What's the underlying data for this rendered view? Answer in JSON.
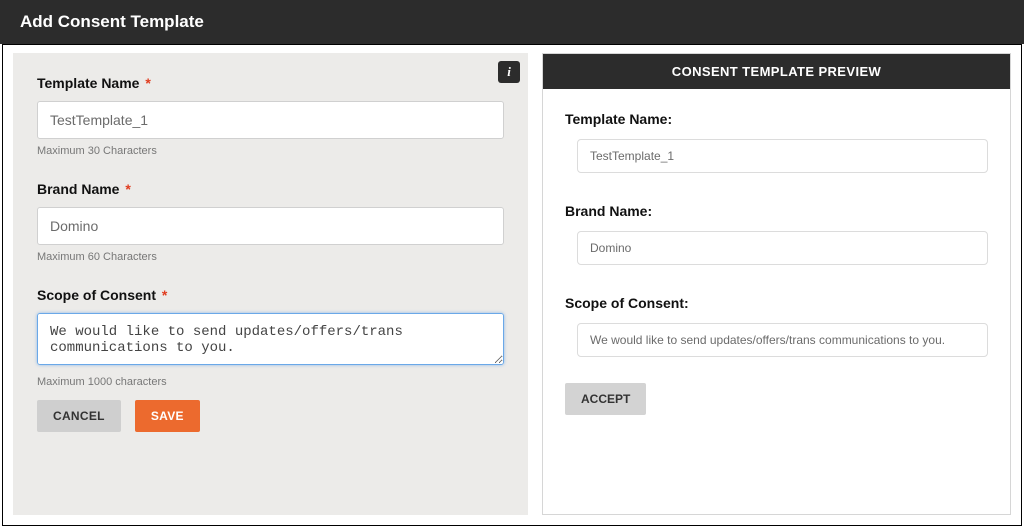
{
  "header": {
    "title": "Add Consent Template"
  },
  "form": {
    "info_icon": "i",
    "template_name": {
      "label": "Template Name",
      "value": "TestTemplate_1",
      "helper": "Maximum 30 Characters"
    },
    "brand_name": {
      "label": "Brand Name",
      "value": "Domino",
      "helper": "Maximum 60 Characters"
    },
    "scope": {
      "label": "Scope of Consent",
      "value": "We would like to send updates/offers/trans communications to you.",
      "helper": "Maximum 1000 characters"
    },
    "buttons": {
      "cancel": "CANCEL",
      "save": "SAVE"
    }
  },
  "preview": {
    "heading": "CONSENT TEMPLATE PREVIEW",
    "template_name_label": "Template Name:",
    "template_name_value": "TestTemplate_1",
    "brand_name_label": "Brand Name:",
    "brand_name_value": "Domino",
    "scope_label": "Scope of Consent:",
    "scope_value": "We would like to send updates/offers/trans communications to you.",
    "accept": "ACCEPT"
  }
}
